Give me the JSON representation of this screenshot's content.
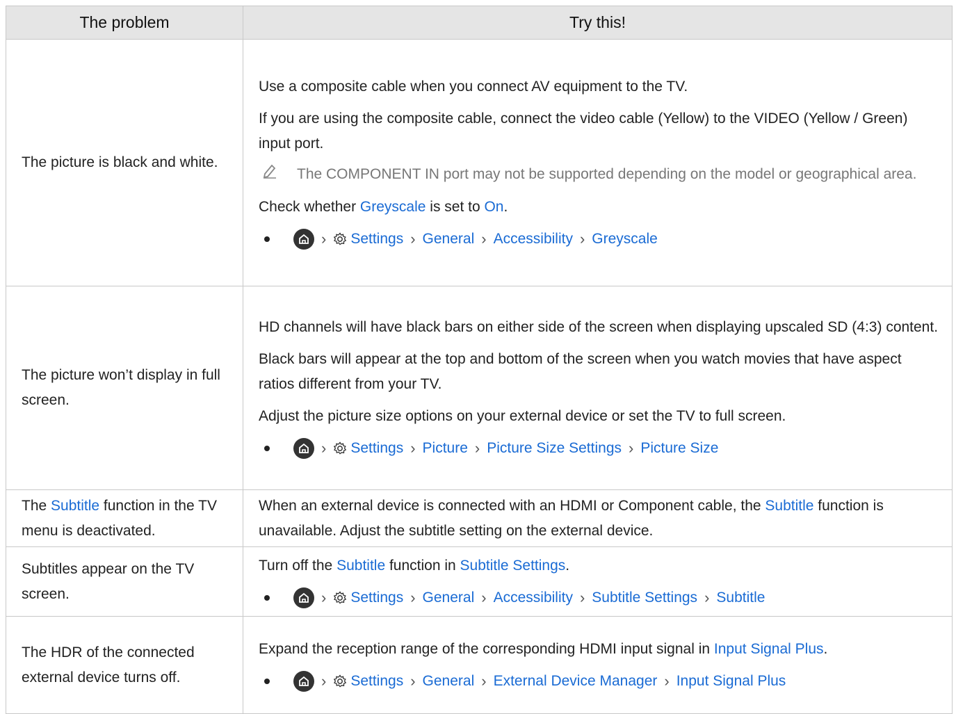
{
  "header": {
    "col1": "The problem",
    "col2": "Try this!"
  },
  "icons": {
    "home": "home-icon",
    "settings": "gear-icon",
    "note": "pencil-note-icon",
    "sep": "chevron-right-icon"
  },
  "colors": {
    "link": "#1a6bd4",
    "header_bg": "#e5e5e5",
    "border": "#c8c8c8"
  },
  "rows": [
    {
      "problem": "The picture is black and white.",
      "p1": "Use a composite cable when you connect AV equipment to the TV.",
      "p2": "If you are using the composite cable, connect the video cable (Yellow) to the VIDEO (Yellow / Green) input port.",
      "note": "The COMPONENT IN port may not be supported depending on the model or geographical area.",
      "p3_a": "Check whether ",
      "p3_link1": "Greyscale",
      "p3_b": " is set to ",
      "p3_link2": "On",
      "p3_c": ".",
      "path": [
        "Settings",
        "General",
        "Accessibility",
        "Greyscale"
      ]
    },
    {
      "problem": "The picture won’t display in full screen.",
      "p1": "HD channels will have black bars on either side of the screen when displaying upscaled SD (4:3) content.",
      "p2": "Black bars will appear at the top and bottom of the screen when you watch movies that have aspect ratios different from your TV.",
      "p3": "Adjust the picture size options on your external device or set the TV to full screen.",
      "path": [
        "Settings",
        "Picture",
        "Picture Size Settings",
        "Picture Size"
      ]
    },
    {
      "problem_a": "The ",
      "problem_link": "Subtitle",
      "problem_b": " function in the TV menu is deactivated.",
      "p1_a": "When an external device is connected with an HDMI or Component cable, the ",
      "p1_link": "Subtitle",
      "p1_b": " function is unavailable. Adjust the subtitle setting on the external device."
    },
    {
      "problem": "Subtitles appear on the TV screen.",
      "p1_a": "Turn off the ",
      "p1_link1": "Subtitle",
      "p1_b": " function in ",
      "p1_link2": "Subtitle Settings",
      "p1_c": ".",
      "path": [
        "Settings",
        "General",
        "Accessibility",
        "Subtitle Settings",
        "Subtitle"
      ]
    },
    {
      "problem": "The HDR of the connected external device turns off.",
      "p1_a": "Expand the reception range of the corresponding HDMI input signal in ",
      "p1_link": "Input Signal Plus",
      "p1_b": ".",
      "path": [
        "Settings",
        "General",
        "External Device Manager",
        "Input Signal Plus"
      ]
    }
  ]
}
